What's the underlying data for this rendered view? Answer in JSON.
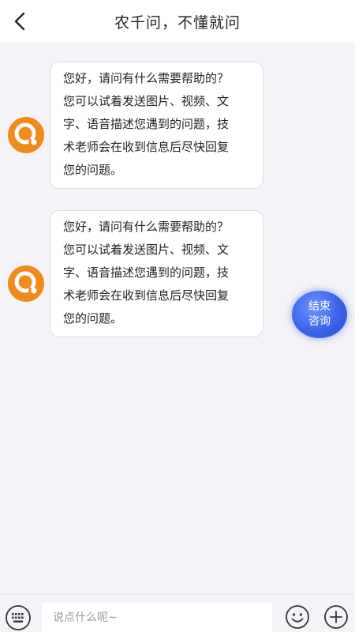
{
  "header": {
    "title": "农千问，不懂就问",
    "back_icon": "chevron-left-icon"
  },
  "messages": [
    {
      "sender": "bot",
      "avatar_icon": "question-chat-logo-icon",
      "text": "您好，请问有什么需要帮助的？\n您可以试着发送图片、视频、文\n字、语音描述您遇到的问题，技\n术老师会在收到信息后尽快回复\n您的问题。"
    },
    {
      "sender": "bot",
      "avatar_icon": "question-chat-logo-icon",
      "text": "您好，请问有什么需要帮助的？\n您可以试着发送图片、视频、文\n字、语音描述您遇到的问题，技\n术老师会在收到信息后尽快回复\n您的问题。"
    }
  ],
  "end_consult": {
    "line1": "结束",
    "line2": "咨询"
  },
  "input_bar": {
    "placeholder": "说点什么呢~",
    "keyboard_icon": "keyboard-icon",
    "emoji_icon": "smiley-icon",
    "plus_icon": "plus-icon"
  },
  "colors": {
    "accent_orange": "#f08a1c",
    "end_button_blue": "#3b64e8",
    "background": "#f4f3f7"
  }
}
